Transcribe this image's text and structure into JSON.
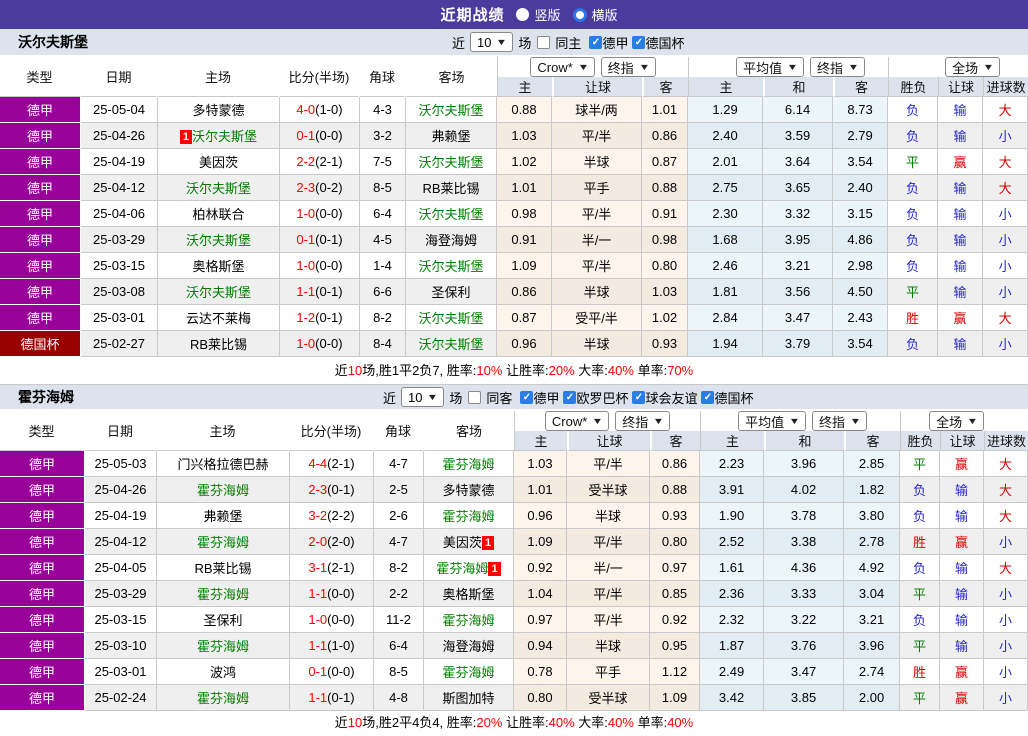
{
  "top_bar": {
    "title": "近期战绩",
    "radio_vertical": "竖版",
    "radio_horizontal": "横版"
  },
  "colors": {
    "top_bar_bg": "#4b3b9c",
    "league_bundesliga": "#990099",
    "league_cup": "#990000",
    "header_bg": "#dce3ed",
    "team_highlight": "#008000",
    "score_red": "#ff0000",
    "red_card_badge": "#ff0000",
    "result_colors": {
      "胜": "#dd0000",
      "平": "#008000",
      "负": "#2727cc",
      "赢": "#dd0000",
      "输": "#2727cc",
      "大": "#dd0000",
      "小": "#2727cc"
    }
  },
  "sections": [
    {
      "team": "沃尔夫斯堡",
      "filters": {
        "near": "近",
        "count": "10",
        "unit": "场",
        "same_label": "同主",
        "same_checked": false,
        "leagues": [
          {
            "label": "德甲",
            "checked": true
          },
          {
            "label": "德国杯",
            "checked": true
          }
        ]
      },
      "columns": {
        "left": [
          "类型",
          "日期",
          "主场",
          "比分(半场)",
          "角球",
          "客场"
        ],
        "odds_selects": [
          "Crow*",
          "终指"
        ],
        "odds_cols": [
          "主",
          "让球",
          "客"
        ],
        "avg_selects": [
          "平均值",
          "终指"
        ],
        "avg_cols": [
          "主",
          "和",
          "客"
        ],
        "full_select": "全场",
        "result_cols": [
          "胜负",
          "让球",
          "进球数"
        ]
      },
      "rows": [
        {
          "league": "德甲",
          "date": "25-05-04",
          "home": "多特蒙德",
          "home_hl": false,
          "score": "4-0",
          "half": "(1-0)",
          "corner": "4-3",
          "away": "沃尔夫斯堡",
          "away_hl": true,
          "odds": [
            "0.88",
            "球半/两",
            "1.01"
          ],
          "avg": [
            "1.29",
            "6.14",
            "8.73"
          ],
          "results": [
            "负",
            "输",
            "大"
          ]
        },
        {
          "league": "德甲",
          "date": "25-04-26",
          "home": "沃尔夫斯堡",
          "home_hl": true,
          "home_badge": "1",
          "home_badge_pos": "before",
          "score": "0-1",
          "half": "(0-0)",
          "corner": "3-2",
          "away": "弗赖堡",
          "away_hl": false,
          "odds": [
            "1.03",
            "平/半",
            "0.86"
          ],
          "avg": [
            "2.40",
            "3.59",
            "2.79"
          ],
          "results": [
            "负",
            "输",
            "小"
          ]
        },
        {
          "league": "德甲",
          "date": "25-04-19",
          "home": "美因茨",
          "home_hl": false,
          "score": "2-2",
          "half": "(2-1)",
          "corner": "7-5",
          "away": "沃尔夫斯堡",
          "away_hl": true,
          "odds": [
            "1.02",
            "半球",
            "0.87"
          ],
          "avg": [
            "2.01",
            "3.64",
            "3.54"
          ],
          "results": [
            "平",
            "赢",
            "大"
          ]
        },
        {
          "league": "德甲",
          "date": "25-04-12",
          "home": "沃尔夫斯堡",
          "home_hl": true,
          "score": "2-3",
          "half": "(0-2)",
          "corner": "8-5",
          "away": "RB莱比锡",
          "away_hl": false,
          "odds": [
            "1.01",
            "平手",
            "0.88"
          ],
          "avg": [
            "2.75",
            "3.65",
            "2.40"
          ],
          "results": [
            "负",
            "输",
            "大"
          ]
        },
        {
          "league": "德甲",
          "date": "25-04-06",
          "home": "柏林联合",
          "home_hl": false,
          "score": "1-0",
          "half": "(0-0)",
          "corner": "6-4",
          "away": "沃尔夫斯堡",
          "away_hl": true,
          "odds": [
            "0.98",
            "平/半",
            "0.91"
          ],
          "avg": [
            "2.30",
            "3.32",
            "3.15"
          ],
          "results": [
            "负",
            "输",
            "小"
          ]
        },
        {
          "league": "德甲",
          "date": "25-03-29",
          "home": "沃尔夫斯堡",
          "home_hl": true,
          "score": "0-1",
          "half": "(0-1)",
          "corner": "4-5",
          "away": "海登海姆",
          "away_hl": false,
          "odds": [
            "0.91",
            "半/一",
            "0.98"
          ],
          "avg": [
            "1.68",
            "3.95",
            "4.86"
          ],
          "results": [
            "负",
            "输",
            "小"
          ]
        },
        {
          "league": "德甲",
          "date": "25-03-15",
          "home": "奥格斯堡",
          "home_hl": false,
          "score": "1-0",
          "half": "(0-0)",
          "corner": "1-4",
          "away": "沃尔夫斯堡",
          "away_hl": true,
          "odds": [
            "1.09",
            "平/半",
            "0.80"
          ],
          "avg": [
            "2.46",
            "3.21",
            "2.98"
          ],
          "results": [
            "负",
            "输",
            "小"
          ]
        },
        {
          "league": "德甲",
          "date": "25-03-08",
          "home": "沃尔夫斯堡",
          "home_hl": true,
          "score": "1-1",
          "half": "(0-1)",
          "corner": "6-6",
          "away": "圣保利",
          "away_hl": false,
          "odds": [
            "0.86",
            "半球",
            "1.03"
          ],
          "avg": [
            "1.81",
            "3.56",
            "4.50"
          ],
          "results": [
            "平",
            "输",
            "小"
          ]
        },
        {
          "league": "德甲",
          "date": "25-03-01",
          "home": "云达不莱梅",
          "home_hl": false,
          "score": "1-2",
          "half": "(0-1)",
          "corner": "8-2",
          "away": "沃尔夫斯堡",
          "away_hl": true,
          "odds": [
            "0.87",
            "受平/半",
            "1.02"
          ],
          "avg": [
            "2.84",
            "3.47",
            "2.43"
          ],
          "results": [
            "胜",
            "赢",
            "大"
          ]
        },
        {
          "league": "德国杯",
          "date": "25-02-27",
          "home": "RB莱比锡",
          "home_hl": false,
          "score": "1-0",
          "half": "(0-0)",
          "corner": "8-4",
          "away": "沃尔夫斯堡",
          "away_hl": true,
          "odds": [
            "0.96",
            "半球",
            "0.93"
          ],
          "avg": [
            "1.94",
            "3.79",
            "3.54"
          ],
          "results": [
            "负",
            "输",
            "小"
          ]
        }
      ],
      "summary": [
        {
          "text": "近",
          "red": false
        },
        {
          "text": "10",
          "red": true
        },
        {
          "text": "场,胜1平2负7, 胜率:",
          "red": false
        },
        {
          "text": "10%",
          "red": true
        },
        {
          "text": " 让胜率:",
          "red": false
        },
        {
          "text": "20%",
          "red": true
        },
        {
          "text": " 大率:",
          "red": false
        },
        {
          "text": "40%",
          "red": true
        },
        {
          "text": " 单率:",
          "red": false
        },
        {
          "text": "70%",
          "red": true
        }
      ]
    },
    {
      "team": "霍芬海姆",
      "filters": {
        "near": "近",
        "count": "10",
        "unit": "场",
        "same_label": "同客",
        "same_checked": false,
        "leagues": [
          {
            "label": "德甲",
            "checked": true
          },
          {
            "label": "欧罗巴杯",
            "checked": true
          },
          {
            "label": "球会友谊",
            "checked": true
          },
          {
            "label": "德国杯",
            "checked": true
          }
        ]
      },
      "columns": {
        "left": [
          "类型",
          "日期",
          "主场",
          "比分(半场)",
          "角球",
          "客场"
        ],
        "odds_selects": [
          "Crow*",
          "终指"
        ],
        "odds_cols": [
          "主",
          "让球",
          "客"
        ],
        "avg_selects": [
          "平均值",
          "终指"
        ],
        "avg_cols": [
          "主",
          "和",
          "客"
        ],
        "full_select": "全场",
        "result_cols": [
          "胜负",
          "让球",
          "进球数"
        ]
      },
      "rows": [
        {
          "league": "德甲",
          "date": "25-05-03",
          "home": "门兴格拉德巴赫",
          "home_hl": false,
          "score": "4-4",
          "half": "(2-1)",
          "corner": "4-7",
          "away": "霍芬海姆",
          "away_hl": true,
          "odds": [
            "1.03",
            "平/半",
            "0.86"
          ],
          "avg": [
            "2.23",
            "3.96",
            "2.85"
          ],
          "results": [
            "平",
            "赢",
            "大"
          ]
        },
        {
          "league": "德甲",
          "date": "25-04-26",
          "home": "霍芬海姆",
          "home_hl": true,
          "score": "2-3",
          "half": "(0-1)",
          "corner": "2-5",
          "away": "多特蒙德",
          "away_hl": false,
          "odds": [
            "1.01",
            "受半球",
            "0.88"
          ],
          "avg": [
            "3.91",
            "4.02",
            "1.82"
          ],
          "results": [
            "负",
            "输",
            "大"
          ]
        },
        {
          "league": "德甲",
          "date": "25-04-19",
          "home": "弗赖堡",
          "home_hl": false,
          "score": "3-2",
          "half": "(2-2)",
          "corner": "2-6",
          "away": "霍芬海姆",
          "away_hl": true,
          "odds": [
            "0.96",
            "半球",
            "0.93"
          ],
          "avg": [
            "1.90",
            "3.78",
            "3.80"
          ],
          "results": [
            "负",
            "输",
            "大"
          ]
        },
        {
          "league": "德甲",
          "date": "25-04-12",
          "home": "霍芬海姆",
          "home_hl": true,
          "score": "2-0",
          "half": "(2-0)",
          "corner": "4-7",
          "away": "美因茨",
          "away_hl": false,
          "away_badge": "1",
          "away_badge_pos": "after",
          "odds": [
            "1.09",
            "平/半",
            "0.80"
          ],
          "avg": [
            "2.52",
            "3.38",
            "2.78"
          ],
          "results": [
            "胜",
            "赢",
            "小"
          ]
        },
        {
          "league": "德甲",
          "date": "25-04-05",
          "home": "RB莱比锡",
          "home_hl": false,
          "score": "3-1",
          "half": "(2-1)",
          "corner": "8-2",
          "away": "霍芬海姆",
          "away_hl": true,
          "away_badge": "1",
          "away_badge_pos": "after",
          "odds": [
            "0.92",
            "半/一",
            "0.97"
          ],
          "avg": [
            "1.61",
            "4.36",
            "4.92"
          ],
          "results": [
            "负",
            "输",
            "大"
          ]
        },
        {
          "league": "德甲",
          "date": "25-03-29",
          "home": "霍芬海姆",
          "home_hl": true,
          "score": "1-1",
          "half": "(0-0)",
          "corner": "2-2",
          "away": "奥格斯堡",
          "away_hl": false,
          "odds": [
            "1.04",
            "平/半",
            "0.85"
          ],
          "avg": [
            "2.36",
            "3.33",
            "3.04"
          ],
          "results": [
            "平",
            "输",
            "小"
          ]
        },
        {
          "league": "德甲",
          "date": "25-03-15",
          "home": "圣保利",
          "home_hl": false,
          "score": "1-0",
          "half": "(0-0)",
          "corner": "11-2",
          "away": "霍芬海姆",
          "away_hl": true,
          "odds": [
            "0.97",
            "平/半",
            "0.92"
          ],
          "avg": [
            "2.32",
            "3.22",
            "3.21"
          ],
          "results": [
            "负",
            "输",
            "小"
          ]
        },
        {
          "league": "德甲",
          "date": "25-03-10",
          "home": "霍芬海姆",
          "home_hl": true,
          "score": "1-1",
          "half": "(1-0)",
          "corner": "6-4",
          "away": "海登海姆",
          "away_hl": false,
          "odds": [
            "0.94",
            "半球",
            "0.95"
          ],
          "avg": [
            "1.87",
            "3.76",
            "3.96"
          ],
          "results": [
            "平",
            "输",
            "小"
          ]
        },
        {
          "league": "德甲",
          "date": "25-03-01",
          "home": "波鸿",
          "home_hl": false,
          "score": "0-1",
          "half": "(0-0)",
          "corner": "8-5",
          "away": "霍芬海姆",
          "away_hl": true,
          "odds": [
            "0.78",
            "平手",
            "1.12"
          ],
          "avg": [
            "2.49",
            "3.47",
            "2.74"
          ],
          "results": [
            "胜",
            "赢",
            "小"
          ]
        },
        {
          "league": "德甲",
          "date": "25-02-24",
          "home": "霍芬海姆",
          "home_hl": true,
          "score": "1-1",
          "half": "(0-1)",
          "corner": "4-8",
          "away": "斯图加特",
          "away_hl": false,
          "odds": [
            "0.80",
            "受半球",
            "1.09"
          ],
          "avg": [
            "3.42",
            "3.85",
            "2.00"
          ],
          "results": [
            "平",
            "赢",
            "小"
          ]
        }
      ],
      "summary": [
        {
          "text": "近",
          "red": false
        },
        {
          "text": "10",
          "red": true
        },
        {
          "text": "场,胜2平4负4, 胜率:",
          "red": false
        },
        {
          "text": "20%",
          "red": true
        },
        {
          "text": " 让胜率:",
          "red": false
        },
        {
          "text": "40%",
          "red": true
        },
        {
          "text": " 大率:",
          "red": false
        },
        {
          "text": "40%",
          "red": true
        },
        {
          "text": " 单率:",
          "red": false
        },
        {
          "text": "40%",
          "red": true
        }
      ]
    }
  ]
}
